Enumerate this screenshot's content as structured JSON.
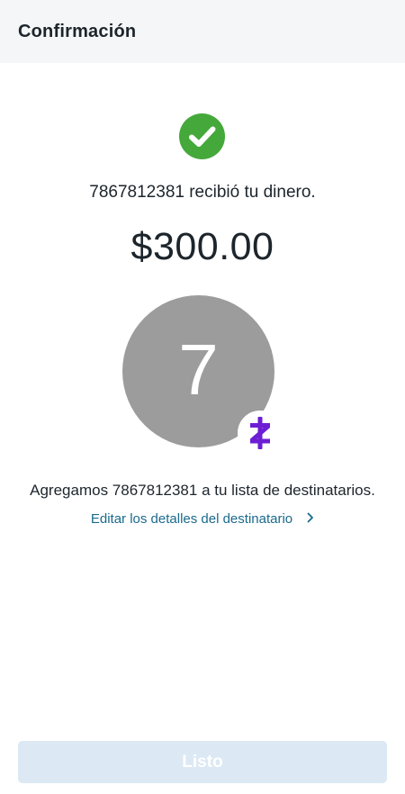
{
  "header": {
    "title": "Confirmación"
  },
  "status": {
    "icon": "check-circle-icon",
    "color": "#44a83a"
  },
  "confirmation": {
    "received_text": "7867812381 recibió tu dinero.",
    "amount": "$300.00"
  },
  "recipient": {
    "avatar_initial": "7",
    "avatar_color": "#9c9c9c",
    "badge_icon": "zelle-logo-icon",
    "badge_color": "#6d1ed4"
  },
  "added_message": "Agregamos 7867812381 a tu lista de destinatarios.",
  "edit_link": {
    "label": "Editar los detalles del destinatario",
    "icon": "chevron-right-icon"
  },
  "footer": {
    "done_label": "Listo"
  }
}
